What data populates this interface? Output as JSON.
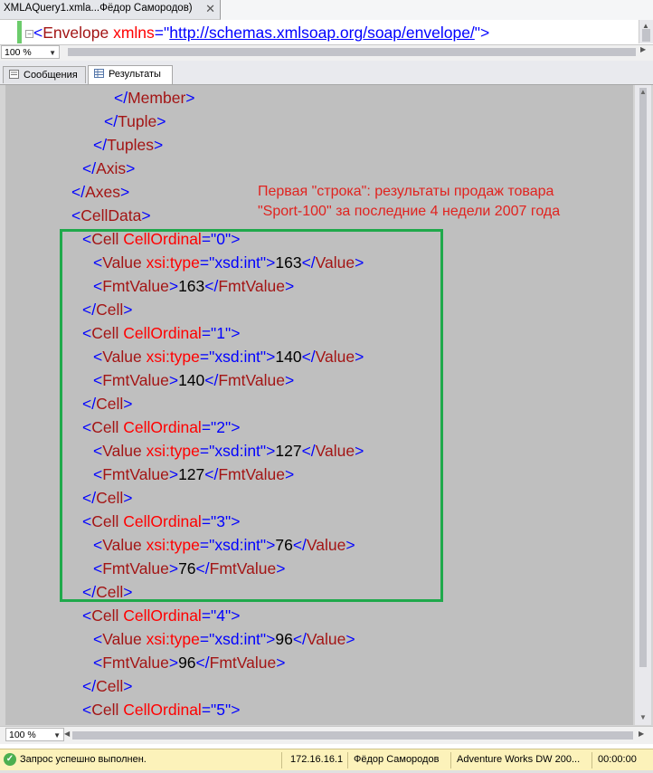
{
  "window": {
    "tab_title": "XMLAQuery1.xmla...Фёдор Самородов)",
    "close_glyph": "✕"
  },
  "top_editor": {
    "open_bracket": "<",
    "tag": "Envelope",
    "attr_name": "xmlns",
    "equals_quote": "=\"",
    "attr_value": "http://schemas.xmlsoap.org/soap/envelope/",
    "close": "\">"
  },
  "top_zoom": {
    "value": "100 %"
  },
  "result_tabs": {
    "messages": "Сообщения",
    "results": "Результаты",
    "active": "results"
  },
  "annotation": {
    "line1": "Первая \"строка\": результаты продаж товара",
    "line2": "\"Sport-100\" за последние 4 недели 2007 года",
    "color": "#e0231f"
  },
  "highlight": {
    "color": "#1fa94b"
  },
  "xml_lines": [
    [
      [
        "p",
        "</"
      ],
      [
        "t",
        "Member"
      ],
      [
        "p",
        ">"
      ]
    ],
    [
      [
        "p",
        "</"
      ],
      [
        "t",
        "Tuple"
      ],
      [
        "p",
        ">"
      ]
    ],
    [
      [
        "p",
        "</"
      ],
      [
        "t",
        "Tuples"
      ],
      [
        "p",
        ">"
      ]
    ],
    [
      [
        "p",
        "</"
      ],
      [
        "t",
        "Axis"
      ],
      [
        "p",
        ">"
      ]
    ],
    [
      [
        "p",
        "</"
      ],
      [
        "t",
        "Axes"
      ],
      [
        "p",
        ">"
      ]
    ],
    [
      [
        "p",
        "<"
      ],
      [
        "t",
        "CellData"
      ],
      [
        "p",
        ">"
      ]
    ],
    [
      [
        "p",
        "<"
      ],
      [
        "t",
        "Cell"
      ],
      [
        "a",
        " CellOrdinal"
      ],
      [
        "p",
        "=\""
      ],
      [
        "v",
        "0"
      ],
      [
        "p",
        "\">"
      ]
    ],
    [
      [
        "p",
        "<"
      ],
      [
        "t",
        "Value"
      ],
      [
        "a",
        " xsi:type"
      ],
      [
        "p",
        "=\""
      ],
      [
        "v",
        "xsd:int"
      ],
      [
        "p",
        "\">"
      ],
      [
        "x",
        "163"
      ],
      [
        "p",
        "</"
      ],
      [
        "t",
        "Value"
      ],
      [
        "p",
        ">"
      ]
    ],
    [
      [
        "p",
        "<"
      ],
      [
        "t",
        "FmtValue"
      ],
      [
        "p",
        ">"
      ],
      [
        "x",
        "163"
      ],
      [
        "p",
        "</"
      ],
      [
        "t",
        "FmtValue"
      ],
      [
        "p",
        ">"
      ]
    ],
    [
      [
        "p",
        "</"
      ],
      [
        "t",
        "Cell"
      ],
      [
        "p",
        ">"
      ]
    ],
    [
      [
        "p",
        "<"
      ],
      [
        "t",
        "Cell"
      ],
      [
        "a",
        " CellOrdinal"
      ],
      [
        "p",
        "=\""
      ],
      [
        "v",
        "1"
      ],
      [
        "p",
        "\">"
      ]
    ],
    [
      [
        "p",
        "<"
      ],
      [
        "t",
        "Value"
      ],
      [
        "a",
        " xsi:type"
      ],
      [
        "p",
        "=\""
      ],
      [
        "v",
        "xsd:int"
      ],
      [
        "p",
        "\">"
      ],
      [
        "x",
        "140"
      ],
      [
        "p",
        "</"
      ],
      [
        "t",
        "Value"
      ],
      [
        "p",
        ">"
      ]
    ],
    [
      [
        "p",
        "<"
      ],
      [
        "t",
        "FmtValue"
      ],
      [
        "p",
        ">"
      ],
      [
        "x",
        "140"
      ],
      [
        "p",
        "</"
      ],
      [
        "t",
        "FmtValue"
      ],
      [
        "p",
        ">"
      ]
    ],
    [
      [
        "p",
        "</"
      ],
      [
        "t",
        "Cell"
      ],
      [
        "p",
        ">"
      ]
    ],
    [
      [
        "p",
        "<"
      ],
      [
        "t",
        "Cell"
      ],
      [
        "a",
        " CellOrdinal"
      ],
      [
        "p",
        "=\""
      ],
      [
        "v",
        "2"
      ],
      [
        "p",
        "\">"
      ]
    ],
    [
      [
        "p",
        "<"
      ],
      [
        "t",
        "Value"
      ],
      [
        "a",
        " xsi:type"
      ],
      [
        "p",
        "=\""
      ],
      [
        "v",
        "xsd:int"
      ],
      [
        "p",
        "\">"
      ],
      [
        "x",
        "127"
      ],
      [
        "p",
        "</"
      ],
      [
        "t",
        "Value"
      ],
      [
        "p",
        ">"
      ]
    ],
    [
      [
        "p",
        "<"
      ],
      [
        "t",
        "FmtValue"
      ],
      [
        "p",
        ">"
      ],
      [
        "x",
        "127"
      ],
      [
        "p",
        "</"
      ],
      [
        "t",
        "FmtValue"
      ],
      [
        "p",
        ">"
      ]
    ],
    [
      [
        "p",
        "</"
      ],
      [
        "t",
        "Cell"
      ],
      [
        "p",
        ">"
      ]
    ],
    [
      [
        "p",
        "<"
      ],
      [
        "t",
        "Cell"
      ],
      [
        "a",
        " CellOrdinal"
      ],
      [
        "p",
        "=\""
      ],
      [
        "v",
        "3"
      ],
      [
        "p",
        "\">"
      ]
    ],
    [
      [
        "p",
        "<"
      ],
      [
        "t",
        "Value"
      ],
      [
        "a",
        " xsi:type"
      ],
      [
        "p",
        "=\""
      ],
      [
        "v",
        "xsd:int"
      ],
      [
        "p",
        "\">"
      ],
      [
        "x",
        "76"
      ],
      [
        "p",
        "</"
      ],
      [
        "t",
        "Value"
      ],
      [
        "p",
        ">"
      ]
    ],
    [
      [
        "p",
        "<"
      ],
      [
        "t",
        "FmtValue"
      ],
      [
        "p",
        ">"
      ],
      [
        "x",
        "76"
      ],
      [
        "p",
        "</"
      ],
      [
        "t",
        "FmtValue"
      ],
      [
        "p",
        ">"
      ]
    ],
    [
      [
        "p",
        "</"
      ],
      [
        "t",
        "Cell"
      ],
      [
        "p",
        ">"
      ]
    ],
    [
      [
        "p",
        "<"
      ],
      [
        "t",
        "Cell"
      ],
      [
        "a",
        " CellOrdinal"
      ],
      [
        "p",
        "=\""
      ],
      [
        "v",
        "4"
      ],
      [
        "p",
        "\">"
      ]
    ],
    [
      [
        "p",
        "<"
      ],
      [
        "t",
        "Value"
      ],
      [
        "a",
        " xsi:type"
      ],
      [
        "p",
        "=\""
      ],
      [
        "v",
        "xsd:int"
      ],
      [
        "p",
        "\">"
      ],
      [
        "x",
        "96"
      ],
      [
        "p",
        "</"
      ],
      [
        "t",
        "Value"
      ],
      [
        "p",
        ">"
      ]
    ],
    [
      [
        "p",
        "<"
      ],
      [
        "t",
        "FmtValue"
      ],
      [
        "p",
        ">"
      ],
      [
        "x",
        "96"
      ],
      [
        "p",
        "</"
      ],
      [
        "t",
        "FmtValue"
      ],
      [
        "p",
        ">"
      ]
    ],
    [
      [
        "p",
        "</"
      ],
      [
        "t",
        "Cell"
      ],
      [
        "p",
        ">"
      ]
    ],
    [
      [
        "p",
        "<"
      ],
      [
        "t",
        "Cell"
      ],
      [
        "a",
        " CellOrdinal"
      ],
      [
        "p",
        "=\""
      ],
      [
        "v",
        "5"
      ],
      [
        "p",
        "\">"
      ]
    ]
  ],
  "syntax_colors": {
    "punct": "#0000ff",
    "tag": "#a31515",
    "attr": "#ff0000",
    "value": "#0000ff",
    "text": "#000000"
  },
  "bottom_zoom": {
    "value": "100 %"
  },
  "status_bar": {
    "message": "Запрос успешно выполнен.",
    "server": "172.16.16.1",
    "user": "Фёдор Самородов",
    "database": "Adventure Works DW 200...",
    "elapsed": "00:00:00",
    "background": "#fcf2ba"
  }
}
